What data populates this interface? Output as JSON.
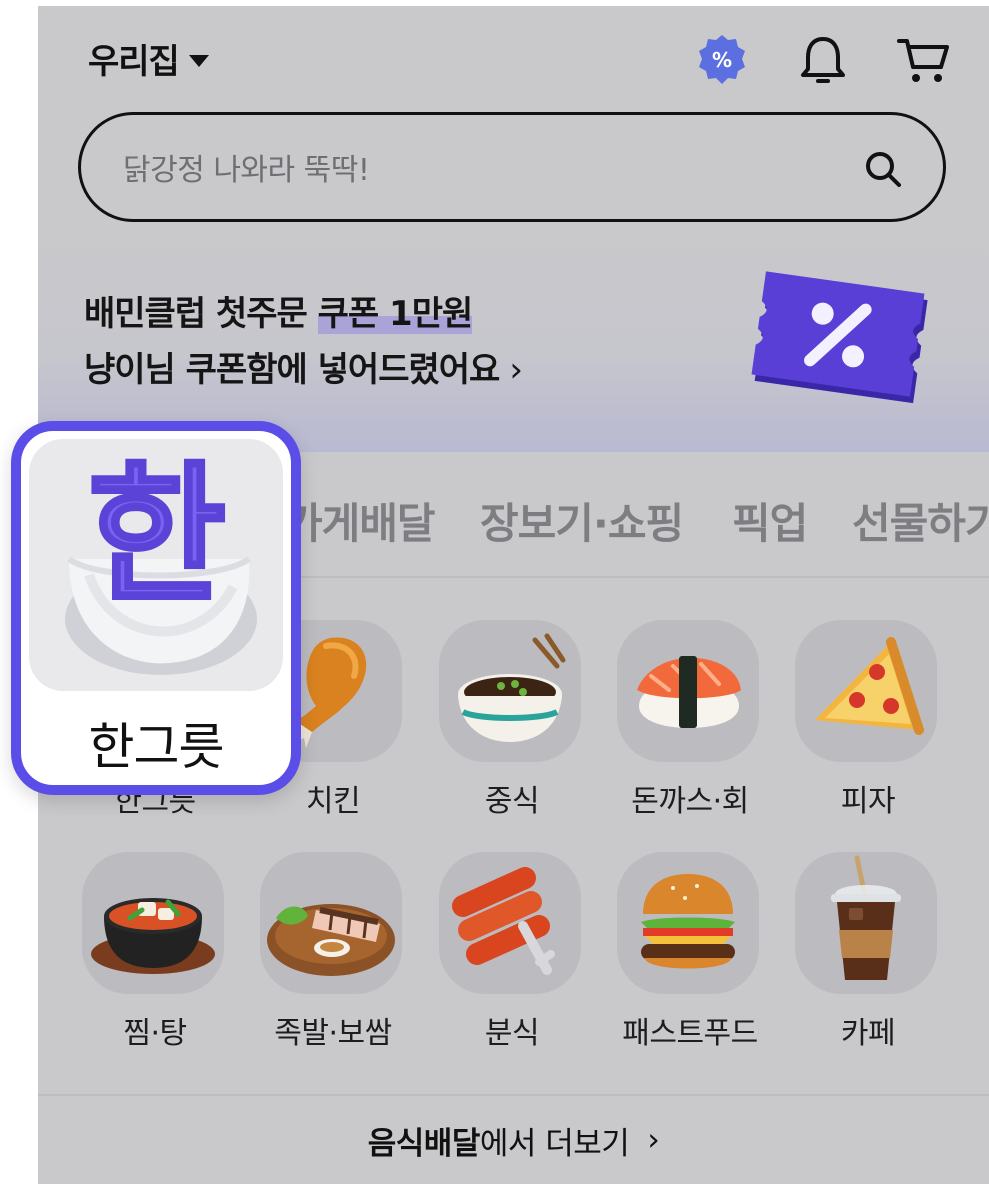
{
  "header": {
    "location_label": "우리집",
    "icons": [
      "discount-badge-icon",
      "bell-icon",
      "cart-icon"
    ]
  },
  "search": {
    "placeholder": "닭강정 나와라 뚝딱!"
  },
  "promo": {
    "line1_prefix": "배민클럽 첫주문 ",
    "line1_highlight": "쿠폰 1만원",
    "line2": "냥이님 쿠폰함에 넣어드렸어요",
    "line2_arrow": "›"
  },
  "tabs": [
    "가게배달",
    "장보기·쇼핑",
    "픽업",
    "선물하기"
  ],
  "categories": [
    {
      "label": "한그릇",
      "icon": "hangrut-bowl-icon"
    },
    {
      "label": "치킨",
      "icon": "chicken-icon"
    },
    {
      "label": "중식",
      "icon": "jajangmyeon-icon"
    },
    {
      "label": "돈까스·회",
      "icon": "sushi-icon"
    },
    {
      "label": "피자",
      "icon": "pizza-icon"
    },
    {
      "label": "찜·탕",
      "icon": "stew-icon"
    },
    {
      "label": "족발·보쌈",
      "icon": "jokbal-icon"
    },
    {
      "label": "분식",
      "icon": "tteokbokki-icon"
    },
    {
      "label": "패스트푸드",
      "icon": "burger-icon"
    },
    {
      "label": "카페",
      "icon": "coffee-icon"
    }
  ],
  "more": {
    "strong": "음식배달",
    "rest": "에서 더보기",
    "arrow": "›"
  },
  "highlight_card": {
    "label": "한그릇",
    "badge_char": "한"
  },
  "colors": {
    "accent": "#5b4de8",
    "dim_bg": "#c9c9cc",
    "ticket": "#5a3fd6"
  }
}
